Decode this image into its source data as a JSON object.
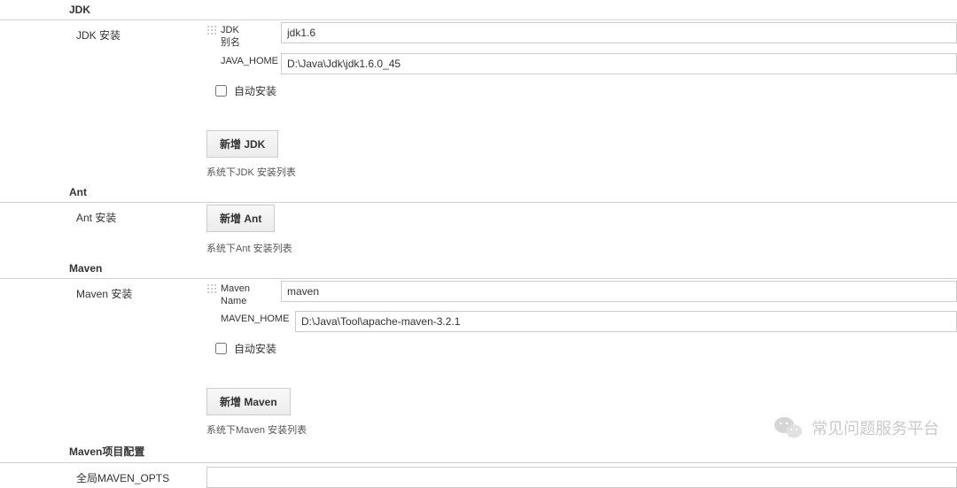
{
  "jdk": {
    "header": "JDK",
    "install_label": "JDK 安装",
    "group_label": "JDK",
    "name_label": "别名",
    "name_value": "jdk1.6",
    "home_label": "JAVA_HOME",
    "home_value": "D:\\Java\\Jdk\\jdk1.6.0_45",
    "auto_install_label": "自动安装",
    "add_button": "新增 JDK",
    "list_text": "系统下JDK 安装列表"
  },
  "ant": {
    "header": "Ant",
    "install_label": "Ant 安装",
    "add_button": "新增 Ant",
    "list_text": "系统下Ant 安装列表"
  },
  "maven": {
    "header": "Maven",
    "install_label": "Maven 安装",
    "group_label": "Maven",
    "name_label": "Name",
    "name_value": "maven",
    "home_label": "MAVEN_HOME",
    "home_value": "D:\\Java\\Tool\\apache-maven-3.2.1",
    "auto_install_label": "自动安装",
    "add_button": "新增 Maven",
    "list_text": "系统下Maven 安装列表"
  },
  "maven_project": {
    "header": "Maven项目配置",
    "opts_label": "全局MAVEN_OPTS",
    "opts_value": ""
  },
  "watermark": {
    "text": "常见问题服务平台"
  }
}
